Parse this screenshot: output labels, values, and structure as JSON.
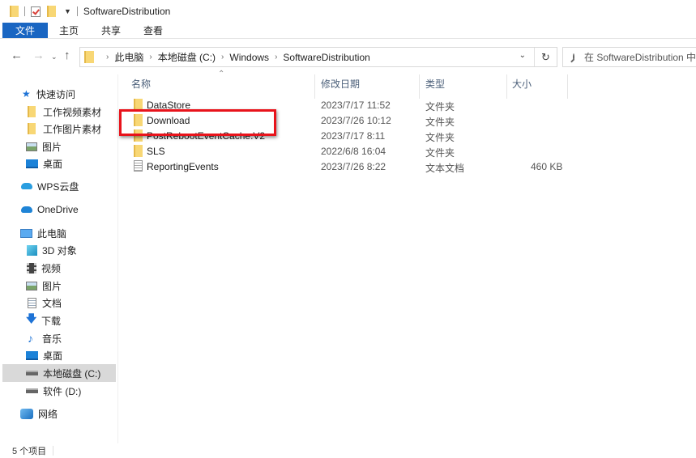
{
  "window": {
    "title": "SoftwareDistribution"
  },
  "ribbon": {
    "tabs": [
      "文件",
      "主页",
      "共享",
      "查看"
    ]
  },
  "address": {
    "breadcrumbs": [
      "此电脑",
      "本地磁盘 (C:)",
      "Windows",
      "SoftwareDistribution"
    ],
    "search_placeholder": "在 SoftwareDistribution 中搜索"
  },
  "sidebar": {
    "items": [
      {
        "label": "快速访问",
        "icon": "star-icon"
      },
      {
        "label": "工作视频素材",
        "icon": "folder-icon"
      },
      {
        "label": "工作图片素材",
        "icon": "folder-icon"
      },
      {
        "label": "图片",
        "icon": "pictures-icon"
      },
      {
        "label": "桌面",
        "icon": "desktop-icon"
      },
      {
        "label": "WPS云盘",
        "icon": "cloud-icon"
      },
      {
        "label": "OneDrive",
        "icon": "cloud-icon"
      },
      {
        "label": "此电脑",
        "icon": "computer-icon"
      },
      {
        "label": "3D 对象",
        "icon": "3d-objects-icon"
      },
      {
        "label": "视频",
        "icon": "video-icon"
      },
      {
        "label": "图片",
        "icon": "pictures-icon"
      },
      {
        "label": "文档",
        "icon": "documents-icon"
      },
      {
        "label": "下载",
        "icon": "download-icon"
      },
      {
        "label": "音乐",
        "icon": "music-icon"
      },
      {
        "label": "桌面",
        "icon": "desktop-icon"
      },
      {
        "label": "本地磁盘 (C:)",
        "icon": "drive-icon",
        "selected": true
      },
      {
        "label": "软件 (D:)",
        "icon": "drive-icon"
      },
      {
        "label": "网络",
        "icon": "network-icon"
      }
    ]
  },
  "columns": {
    "name": "名称",
    "date": "修改日期",
    "type": "类型",
    "size": "大小"
  },
  "files": [
    {
      "name": "DataStore",
      "date": "2023/7/17 11:52",
      "type": "文件夹",
      "size": "",
      "kind": "folder"
    },
    {
      "name": "Download",
      "date": "2023/7/26 10:12",
      "type": "文件夹",
      "size": "",
      "kind": "folder",
      "highlighted": true
    },
    {
      "name": "PostRebootEventCache.V2",
      "date": "2023/7/17 8:11",
      "type": "文件夹",
      "size": "",
      "kind": "folder"
    },
    {
      "name": "SLS",
      "date": "2022/6/8 16:04",
      "type": "文件夹",
      "size": "",
      "kind": "folder"
    },
    {
      "name": "ReportingEvents",
      "date": "2023/7/26 8:22",
      "type": "文本文档",
      "size": "460 KB",
      "kind": "text"
    }
  ],
  "status": {
    "item_count": "5 个项目"
  },
  "colors": {
    "accent": "#1a66c2",
    "highlight_box": "#e8131b",
    "selected_bg": "#d9d9d9"
  }
}
